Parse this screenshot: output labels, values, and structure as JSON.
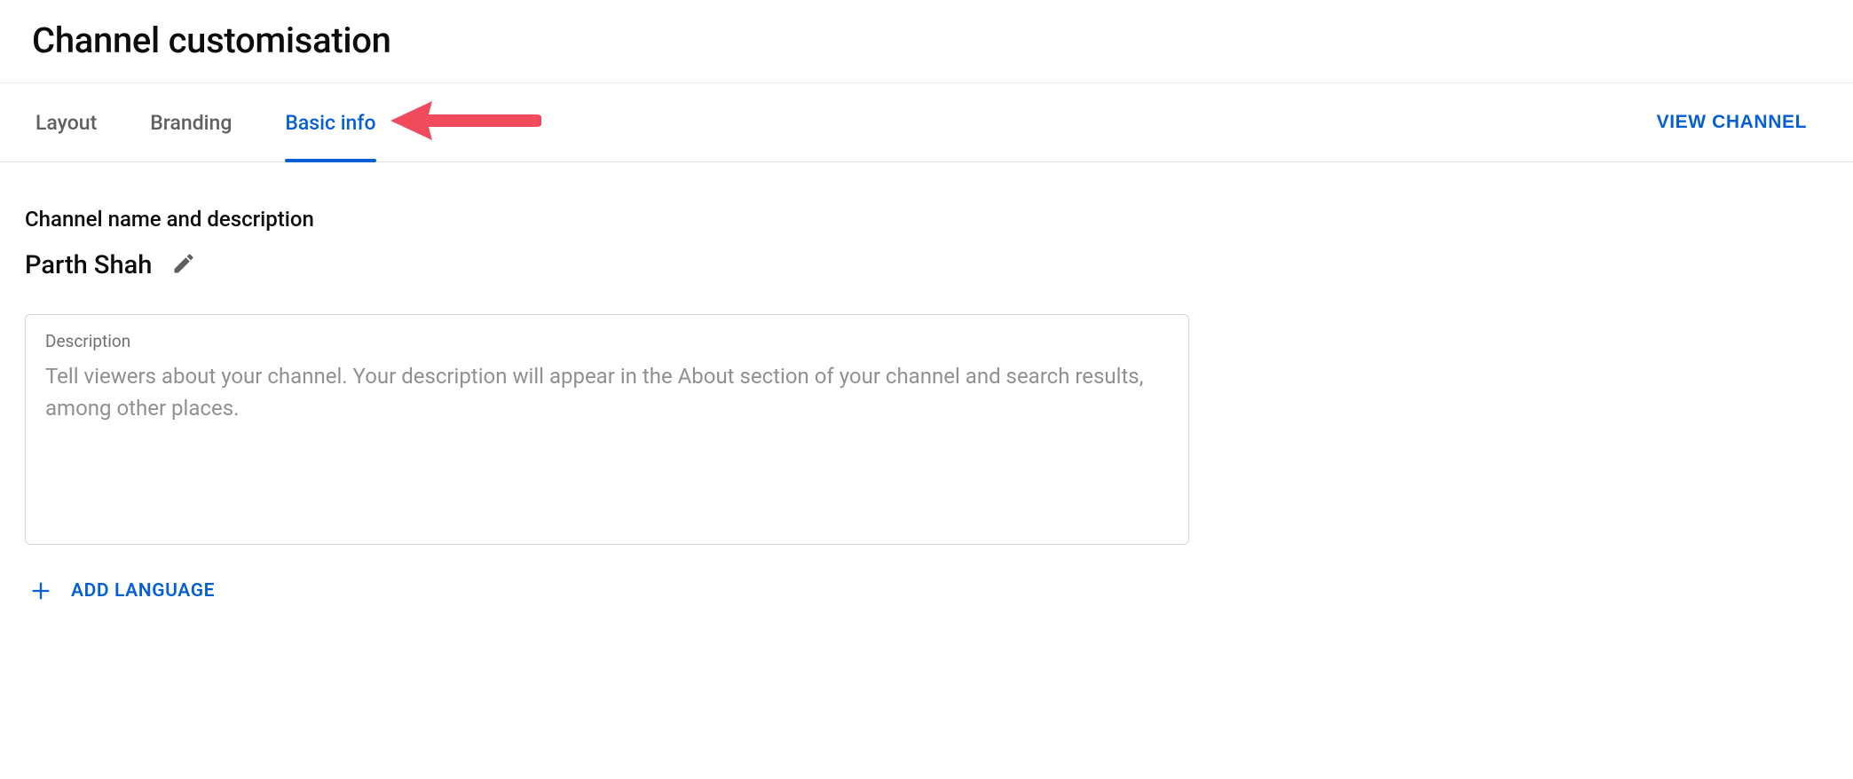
{
  "header": {
    "title": "Channel customisation"
  },
  "tabs": {
    "items": [
      {
        "label": "Layout",
        "active": false
      },
      {
        "label": "Branding",
        "active": false
      },
      {
        "label": "Basic info",
        "active": true
      }
    ],
    "view_channel_label": "VIEW CHANNEL"
  },
  "section": {
    "heading": "Channel name and description",
    "channel_name": "Parth Shah"
  },
  "description": {
    "label": "Description",
    "placeholder": "Tell viewers about your channel. Your description will appear in the About section of your channel and search results, among other places.",
    "value": ""
  },
  "add_language": {
    "label": "ADD LANGUAGE"
  },
  "colors": {
    "accent": "#065fd4",
    "annotation": "#f04a5d"
  }
}
